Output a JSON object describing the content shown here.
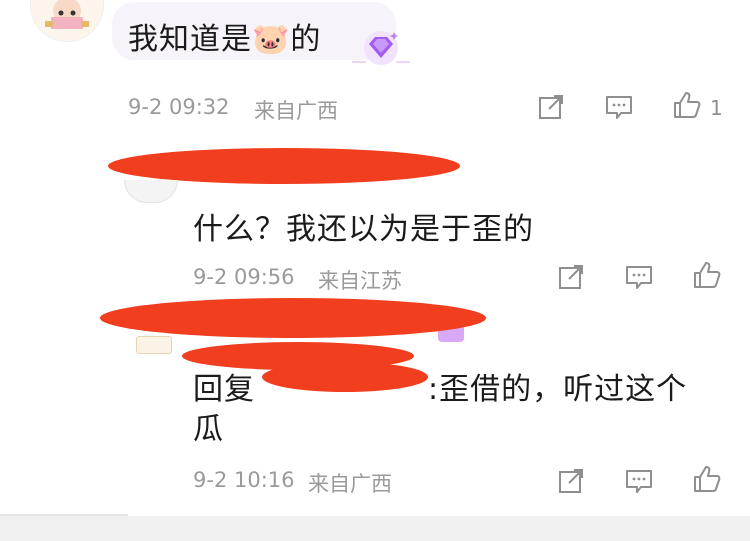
{
  "comments": [
    {
      "text": "我知道是🐷的",
      "time": "9-2 09:32",
      "location": "来自广西",
      "like_count": "1"
    },
    {
      "text": "什么？我还以为是于歪的",
      "time": "9-2 09:56",
      "location": "来自江苏",
      "like_count": ""
    },
    {
      "reply_prefix": "回复",
      "text_line1": ":歪借的，听过这个",
      "text_line2": "瓜",
      "time": "9-2 10:16",
      "location": "来自广西",
      "like_count": ""
    }
  ],
  "icons": {
    "share": "share-icon",
    "comment": "comment-icon",
    "like": "thumbs-up-icon",
    "badge": "diamond-badge-icon"
  },
  "colors": {
    "redaction": "#f03e1e",
    "badge": "#a15cf0",
    "meta": "#9a9a9a"
  }
}
